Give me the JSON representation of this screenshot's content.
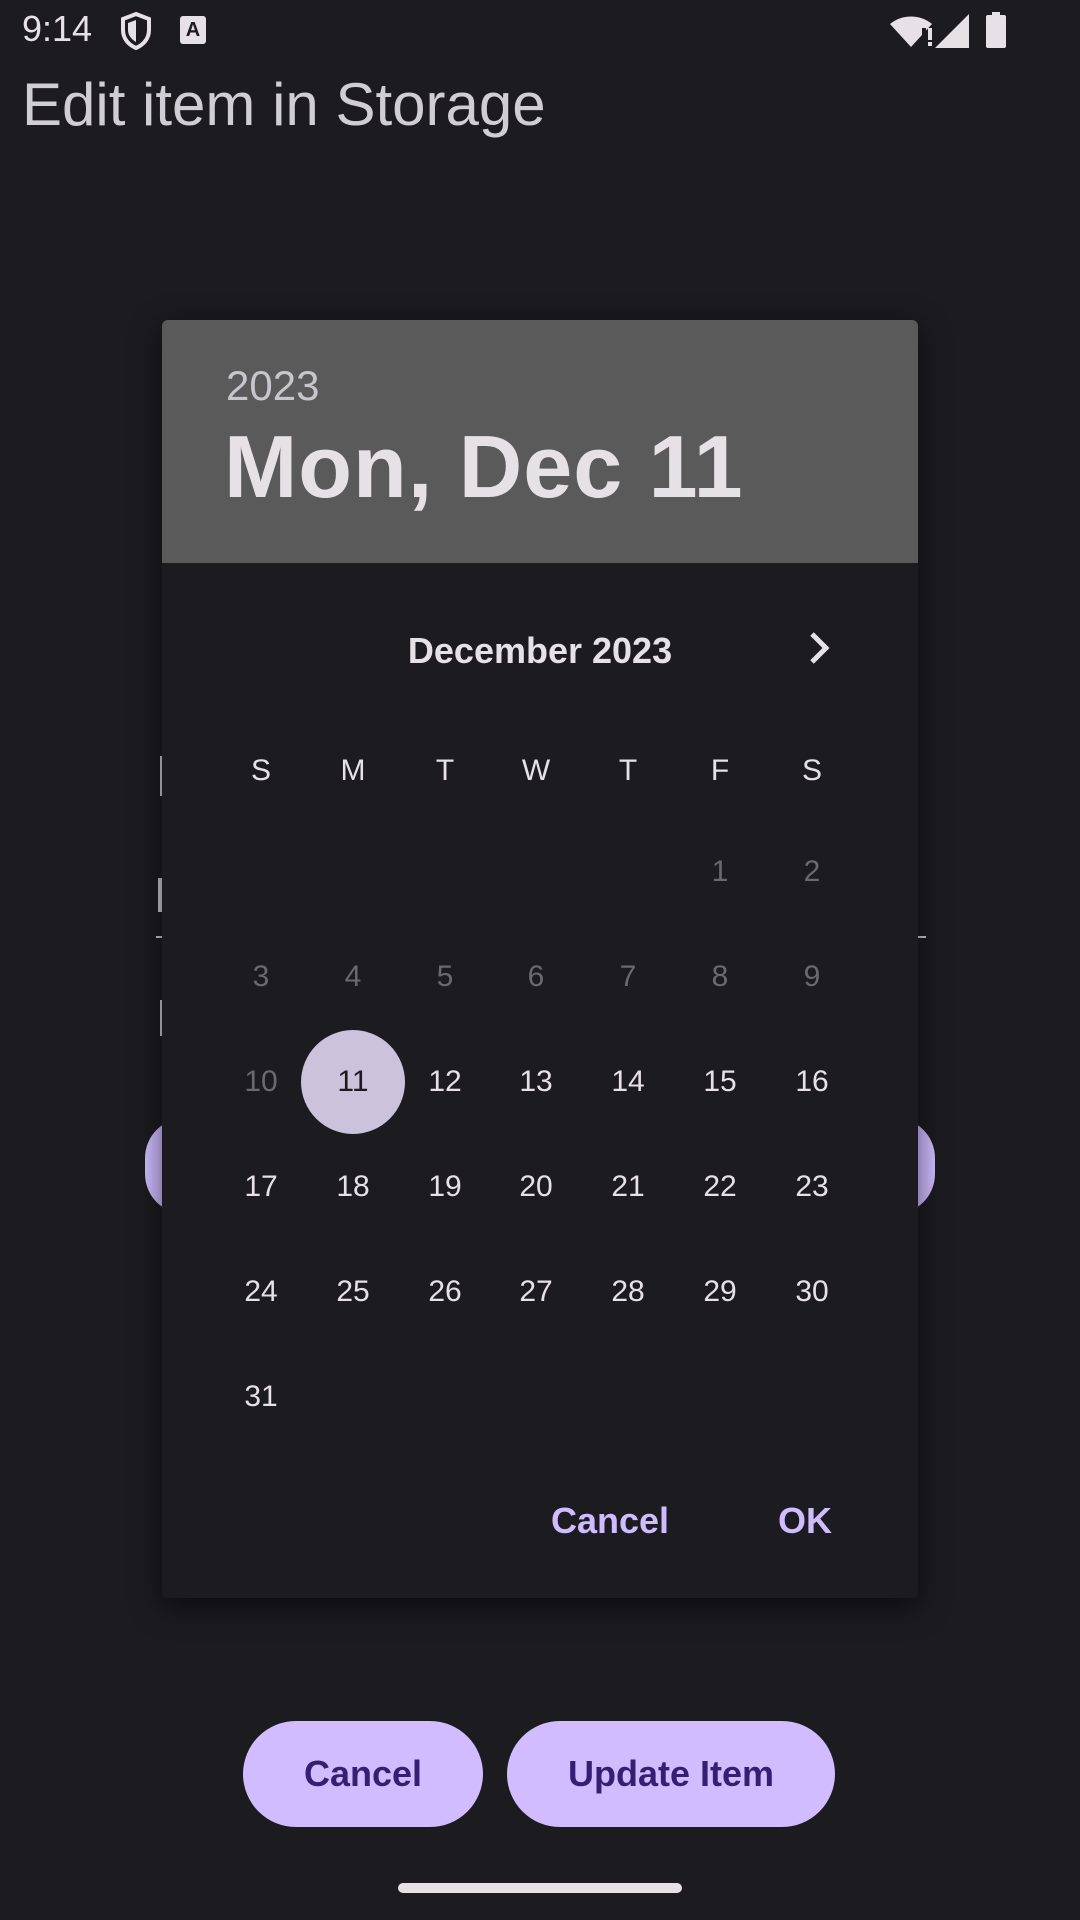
{
  "status_bar": {
    "time": "9:14",
    "icons": [
      "shield-icon",
      "a-badge-icon",
      "wifi-icon",
      "signal-icon",
      "battery-icon"
    ]
  },
  "page": {
    "title": "Edit item in Storage"
  },
  "dialog": {
    "year": "2023",
    "selected_date_label": "Mon, Dec 11",
    "month_label": "December 2023",
    "weekdays": [
      "S",
      "M",
      "T",
      "W",
      "T",
      "F",
      "S"
    ],
    "days": {
      "row1": [
        "1",
        "2"
      ],
      "row2": [
        "3",
        "4",
        "5",
        "6",
        "7",
        "8",
        "9"
      ],
      "row3": [
        "10",
        "11",
        "12",
        "13",
        "14",
        "15",
        "16"
      ],
      "row4": [
        "17",
        "18",
        "19",
        "20",
        "21",
        "22",
        "23"
      ],
      "row5": [
        "24",
        "25",
        "26",
        "27",
        "28",
        "29",
        "30"
      ],
      "row6": [
        "31"
      ]
    },
    "cancel_label": "Cancel",
    "ok_label": "OK"
  },
  "actions": {
    "cancel_label": "Cancel",
    "update_label": "Update Item"
  },
  "colors": {
    "accent": "#cfbcff",
    "button_bg": "#d0bcff",
    "button_text": "#381e72",
    "header_bg": "#5a5a5a",
    "background": "#1c1b1f"
  }
}
